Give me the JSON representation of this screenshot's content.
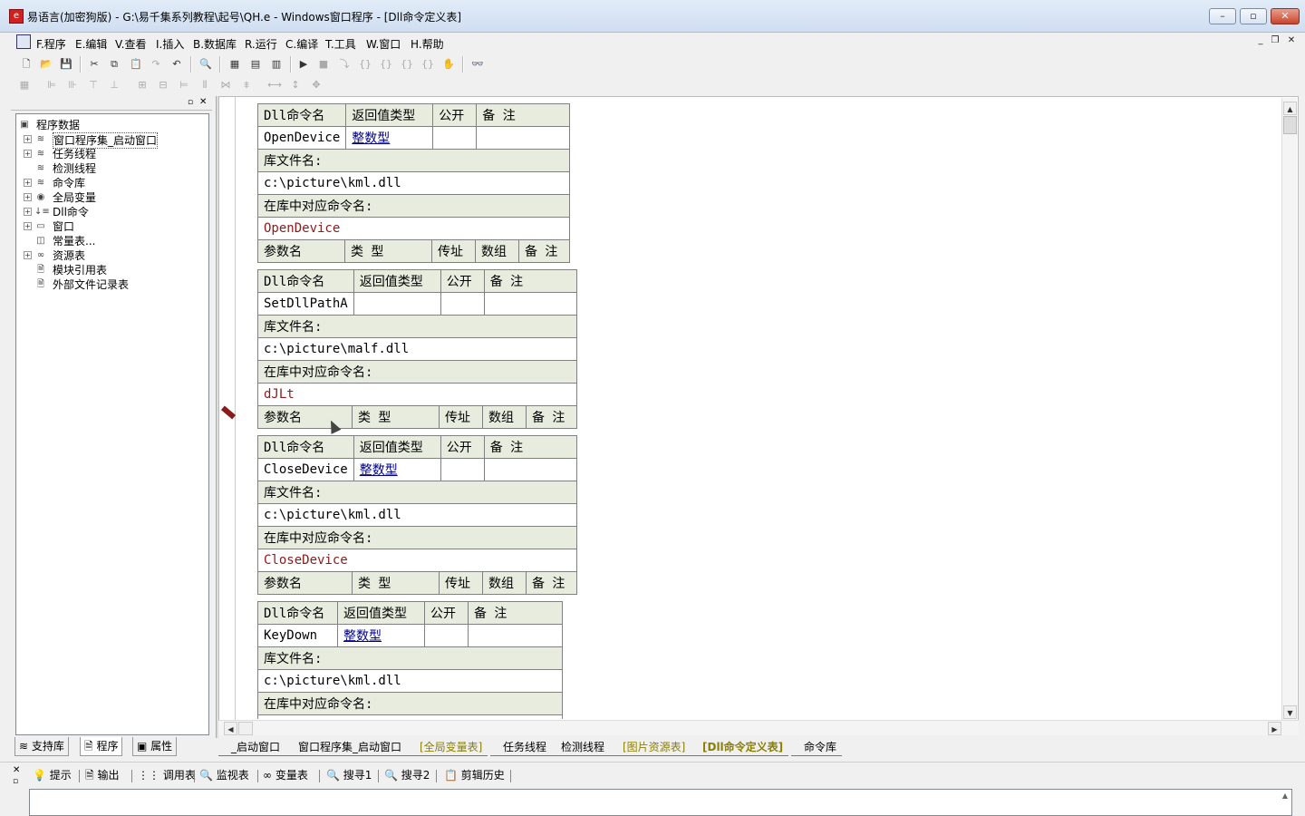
{
  "window": {
    "title": "易语言(加密狗版) - G:\\易千集系列教程\\起号\\QH.e - Windows窗口程序 - [Dll命令定义表]",
    "app_icon": "e-logo-icon",
    "min": "–",
    "max": "▫",
    "close": "✕"
  },
  "menu": [
    "F.程序",
    "E.编辑",
    "V.查看",
    "I.插入",
    "B.数据库",
    "R.运行",
    "C.编译",
    "T.工具",
    "W.窗口",
    "H.帮助"
  ],
  "tree": {
    "root": "程序数据",
    "items": [
      "窗口程序集_启动窗口",
      "任务线程",
      "检测线程",
      "命令库",
      "全局变量",
      "Dll命令",
      "窗口",
      "常量表...",
      "资源表",
      "模块引用表",
      "外部文件记录表"
    ]
  },
  "left_tabs": [
    "支持库",
    "程序",
    "属性"
  ],
  "dll_headers": {
    "name": "Dll命令名",
    "ret": "返回值类型",
    "pub": "公开",
    "note": "备 注",
    "lib": "库文件名:",
    "func": "在库中对应命令名:",
    "param": "参数名",
    "ptype": "类 型",
    "ref": "传址",
    "arr": "数组",
    "pnote": "备 注"
  },
  "dll_commands": [
    {
      "name": "OpenDevice",
      "ret": "整数型",
      "lib": "c:\\picture\\kml.dll",
      "func": "OpenDevice"
    },
    {
      "name": "SetDllPathA",
      "ret": "",
      "lib": "c:\\picture\\malf.dll",
      "func": "dJLt"
    },
    {
      "name": "CloseDevice",
      "ret": "整数型",
      "lib": "c:\\picture\\kml.dll",
      "func": "CloseDevice"
    },
    {
      "name": "KeyDown",
      "ret": "整数型",
      "lib": "c:\\picture\\kml.dll",
      "func": ""
    }
  ],
  "editor_tabs": [
    "_启动窗口",
    "窗口程序集_启动窗口",
    "[全局变量表]",
    "任务线程",
    "检测线程",
    "[图片资源表]",
    "[Dll命令定义表]",
    "命令库"
  ],
  "bottom_tabs": [
    "提示",
    "输出",
    "调用表",
    "监视表",
    "变量表",
    "搜寻1",
    "搜寻2",
    "剪辑历史"
  ],
  "colors": {
    "header_bg": "#e8ecdf",
    "type_link": "#00008b",
    "func_name": "#8b1a1a",
    "tab_yellow": "#8b8000"
  }
}
